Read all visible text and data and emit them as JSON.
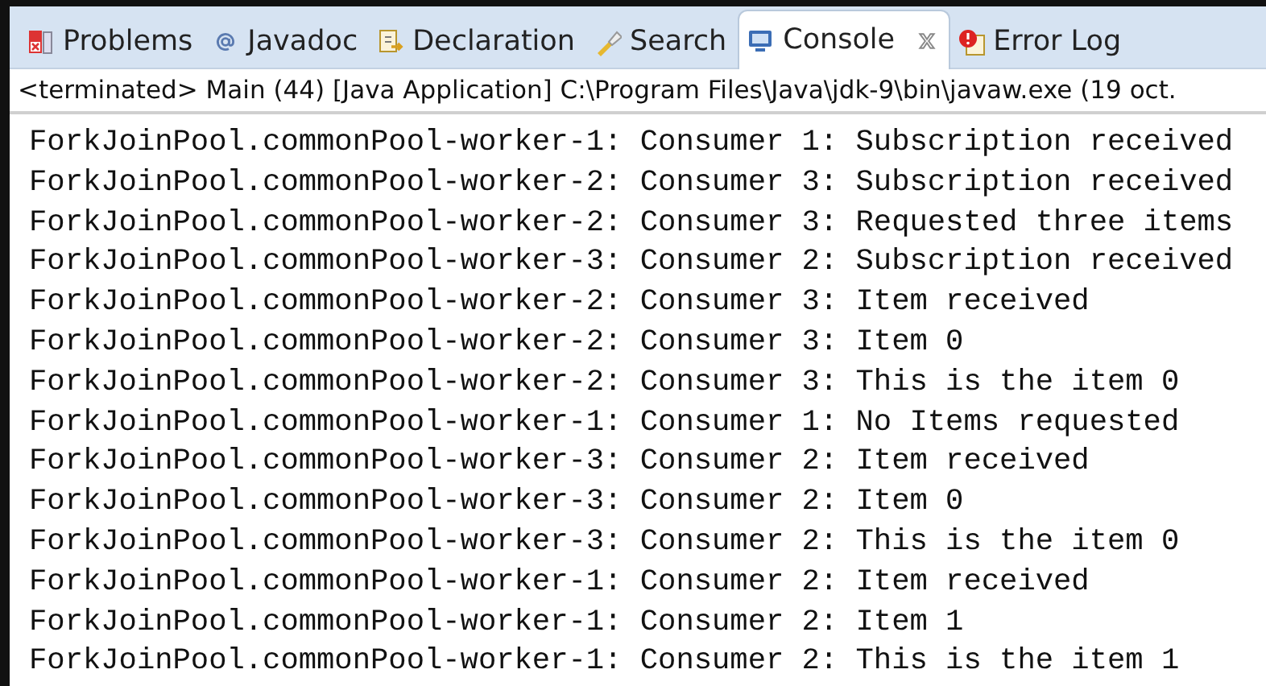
{
  "tabs": [
    {
      "label": "Problems",
      "selected": false
    },
    {
      "label": "Javadoc",
      "selected": false
    },
    {
      "label": "Declaration",
      "selected": false
    },
    {
      "label": "Search",
      "selected": false
    },
    {
      "label": "Console",
      "selected": true
    },
    {
      "label": "Error Log",
      "selected": false
    }
  ],
  "console": {
    "status": "<terminated> Main (44) [Java Application] C:\\Program Files\\Java\\jdk-9\\bin\\javaw.exe (19 oct.",
    "lines": [
      "ForkJoinPool.commonPool-worker-1: Consumer 1: Subscription received",
      "ForkJoinPool.commonPool-worker-2: Consumer 3: Subscription received",
      "ForkJoinPool.commonPool-worker-2: Consumer 3: Requested three items",
      "ForkJoinPool.commonPool-worker-3: Consumer 2: Subscription received",
      "ForkJoinPool.commonPool-worker-2: Consumer 3: Item received",
      "ForkJoinPool.commonPool-worker-2: Consumer 3: Item 0",
      "ForkJoinPool.commonPool-worker-2: Consumer 3: This is the item 0",
      "ForkJoinPool.commonPool-worker-1: Consumer 1: No Items requested",
      "ForkJoinPool.commonPool-worker-3: Consumer 2: Item received",
      "ForkJoinPool.commonPool-worker-3: Consumer 2: Item 0",
      "ForkJoinPool.commonPool-worker-3: Consumer 2: This is the item 0",
      "ForkJoinPool.commonPool-worker-1: Consumer 2: Item received",
      "ForkJoinPool.commonPool-worker-1: Consumer 2: Item 1",
      "ForkJoinPool.commonPool-worker-1: Consumer 2: This is the item 1"
    ]
  }
}
